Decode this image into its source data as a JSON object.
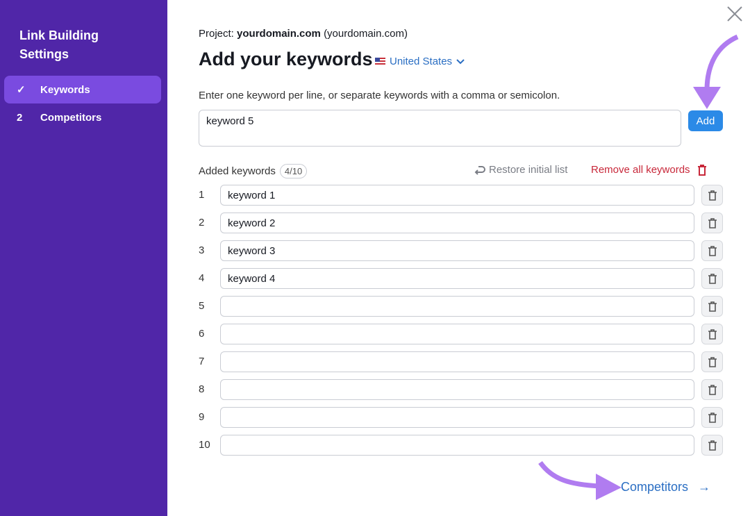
{
  "sidebar": {
    "title": "Link Building Settings",
    "items": [
      {
        "mark": "✓",
        "label": "Keywords",
        "active": true
      },
      {
        "mark": "2",
        "label": "Competitors",
        "active": false
      }
    ]
  },
  "header": {
    "project_label": "Project:",
    "project_name": "yourdomain.com",
    "project_domain": "(yourdomain.com)",
    "title": "Add your keywords",
    "country": "United States"
  },
  "input": {
    "hint": "Enter one keyword per line, or separate keywords with a comma or semicolon.",
    "value": "keyword 5",
    "add_label": "Add"
  },
  "list": {
    "label": "Added keywords",
    "count": "4/10",
    "restore_label": "Restore initial list",
    "remove_all_label": "Remove all keywords",
    "rows": [
      {
        "num": "1",
        "value": "keyword 1"
      },
      {
        "num": "2",
        "value": "keyword 2"
      },
      {
        "num": "3",
        "value": "keyword 3"
      },
      {
        "num": "4",
        "value": "keyword 4"
      },
      {
        "num": "5",
        "value": ""
      },
      {
        "num": "6",
        "value": ""
      },
      {
        "num": "7",
        "value": ""
      },
      {
        "num": "8",
        "value": ""
      },
      {
        "num": "9",
        "value": ""
      },
      {
        "num": "10",
        "value": ""
      }
    ]
  },
  "footer": {
    "next_label": "Competitors",
    "next_arrow": "→"
  },
  "colors": {
    "sidebar": "#5026a8",
    "active": "#7a4be0",
    "link": "#2a6ec3",
    "danger": "#c8283a",
    "annotation": "#b07cf0"
  }
}
